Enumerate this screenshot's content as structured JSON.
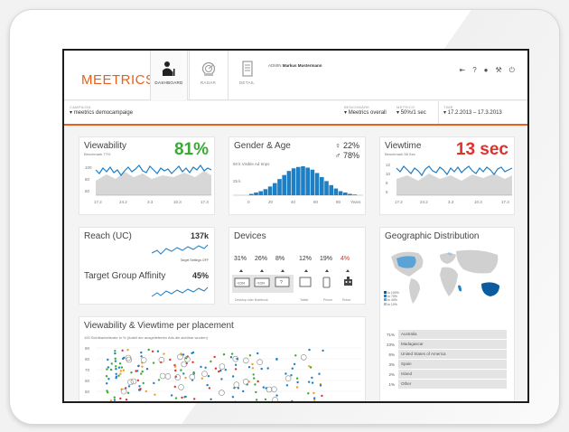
{
  "brand": {
    "logo_text": "MEETRICS",
    "accent": "#e8601c"
  },
  "nav": {
    "tabs": [
      {
        "label": "DASHBOARD",
        "icon": "dashboard-icon",
        "active": true
      },
      {
        "label": "RADAR",
        "icon": "radar-icon",
        "active": false
      },
      {
        "label": "DETAIL",
        "icon": "detail-icon",
        "active": false
      }
    ],
    "admin_role": "ADMIN",
    "admin_name": "Markus Mustermann",
    "util_icons": [
      "logout-icon",
      "help-icon",
      "user-icon",
      "settings-wrench-icon",
      "power-icon"
    ]
  },
  "filters": {
    "campaign_caption": "CAMPAIGN",
    "campaign_value": "meetrics democampaige",
    "benchmark_caption": "BENCHMARK",
    "benchmark_value": "Meetrics overall",
    "metrics_caption": "METRICS",
    "metrics_value": "50%/1 sec",
    "time_caption": "TIME",
    "time_value": "17.2.2013 – 17.3.2013"
  },
  "viewability": {
    "title": "Viewability",
    "subtitle": "Benchmark 77%",
    "value": "81%",
    "value_color": "#3aaa35",
    "y_ticks": [
      "100",
      "80",
      "60"
    ],
    "x_ticks": [
      "17.2",
      "24.2",
      "3.3",
      "10.3",
      "17.3"
    ]
  },
  "gender_age": {
    "title": "Gender & Age",
    "female_pct": "22%",
    "male_pct": "78%",
    "female_icon": "female-icon",
    "male_icon": "male-icon",
    "y_label": "50 k Visible Ad Imps",
    "y_mid_label": "25 k",
    "x_ticks": [
      "0",
      "20",
      "40",
      "60",
      "80",
      "Years"
    ],
    "histogram": [
      2,
      4,
      6,
      9,
      13,
      18,
      24,
      30,
      36,
      40,
      42,
      43,
      41,
      38,
      33,
      27,
      21,
      15,
      10,
      6,
      4,
      2,
      1
    ],
    "bar_color": "#1f7fc4"
  },
  "viewtime": {
    "title": "Viewtime",
    "subtitle": "Benchmark 58 Sec",
    "value": "13 sec",
    "value_color": "#e0312b",
    "y_ticks": [
      "12",
      "10",
      "8",
      "6"
    ],
    "x_ticks": [
      "17.2",
      "24.2",
      "3.3",
      "10.3",
      "17.3"
    ]
  },
  "reach": {
    "title": "Reach (UC)",
    "value": "137k",
    "target_settings": "Target Settings OFF",
    "affinity_title": "Target Group Affinity",
    "affinity_value": "45%"
  },
  "devices": {
    "title": "Devices",
    "items": [
      {
        "pct": "31%",
        "icon": "desktop-1024-icon",
        "color": "#333333"
      },
      {
        "pct": "26%",
        "icon": "desktop-1024-icon",
        "color": "#333333"
      },
      {
        "pct": "8%",
        "icon": "notebook-icon",
        "color": "#333333"
      },
      {
        "pct": "12%",
        "icon": "tablet-icon",
        "color": "#333333"
      },
      {
        "pct": "19%",
        "icon": "phone-icon",
        "color": "#333333"
      },
      {
        "pct": "4%",
        "icon": "robot-icon",
        "color": "#e0312b"
      }
    ],
    "labels": [
      "Desktop oder Notebook",
      "Tablet",
      "Phone",
      "Robot"
    ]
  },
  "geo": {
    "title": "Geographic Distribution",
    "legend": [
      "to 100%",
      "to 75%",
      "to 40%",
      "to 10%"
    ],
    "rows": [
      {
        "pct": "71%",
        "name": "Australia"
      },
      {
        "pct": "23%",
        "name": "Madagascar"
      },
      {
        "pct": "6%",
        "name": "United States of America"
      },
      {
        "pct": "3%",
        "name": "Spain"
      },
      {
        "pct": "2%",
        "name": "Island"
      },
      {
        "pct": "1%",
        "name": "Other"
      }
    ]
  },
  "placement": {
    "title": "Viewability & Viewtime per placement",
    "subtitle": "100  Sichtbarkeitsrate in % (Anteil der ausgelieferten Ads die sichtbar wurden)",
    "y_ticks": [
      "90",
      "80",
      "70",
      "60",
      "50"
    ]
  }
}
